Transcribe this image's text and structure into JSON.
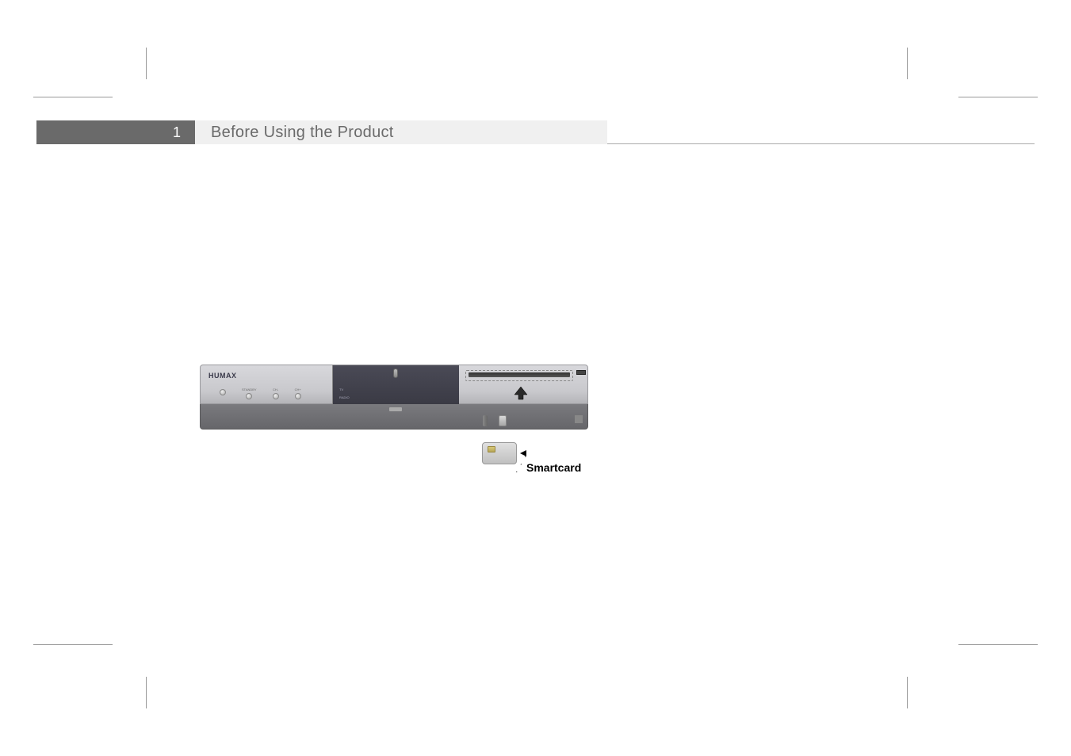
{
  "chapter": {
    "number": "1",
    "title": "Before Using the Product"
  },
  "device": {
    "brand": "HUMAX",
    "leds": [
      {
        "label": ""
      },
      {
        "label": "STANDBY"
      },
      {
        "label": "CH-"
      },
      {
        "label": "CH+"
      }
    ],
    "panel": {
      "tv": "TV",
      "radio": "RADIO"
    }
  },
  "callouts": {
    "smartcard": "Smartcard"
  }
}
